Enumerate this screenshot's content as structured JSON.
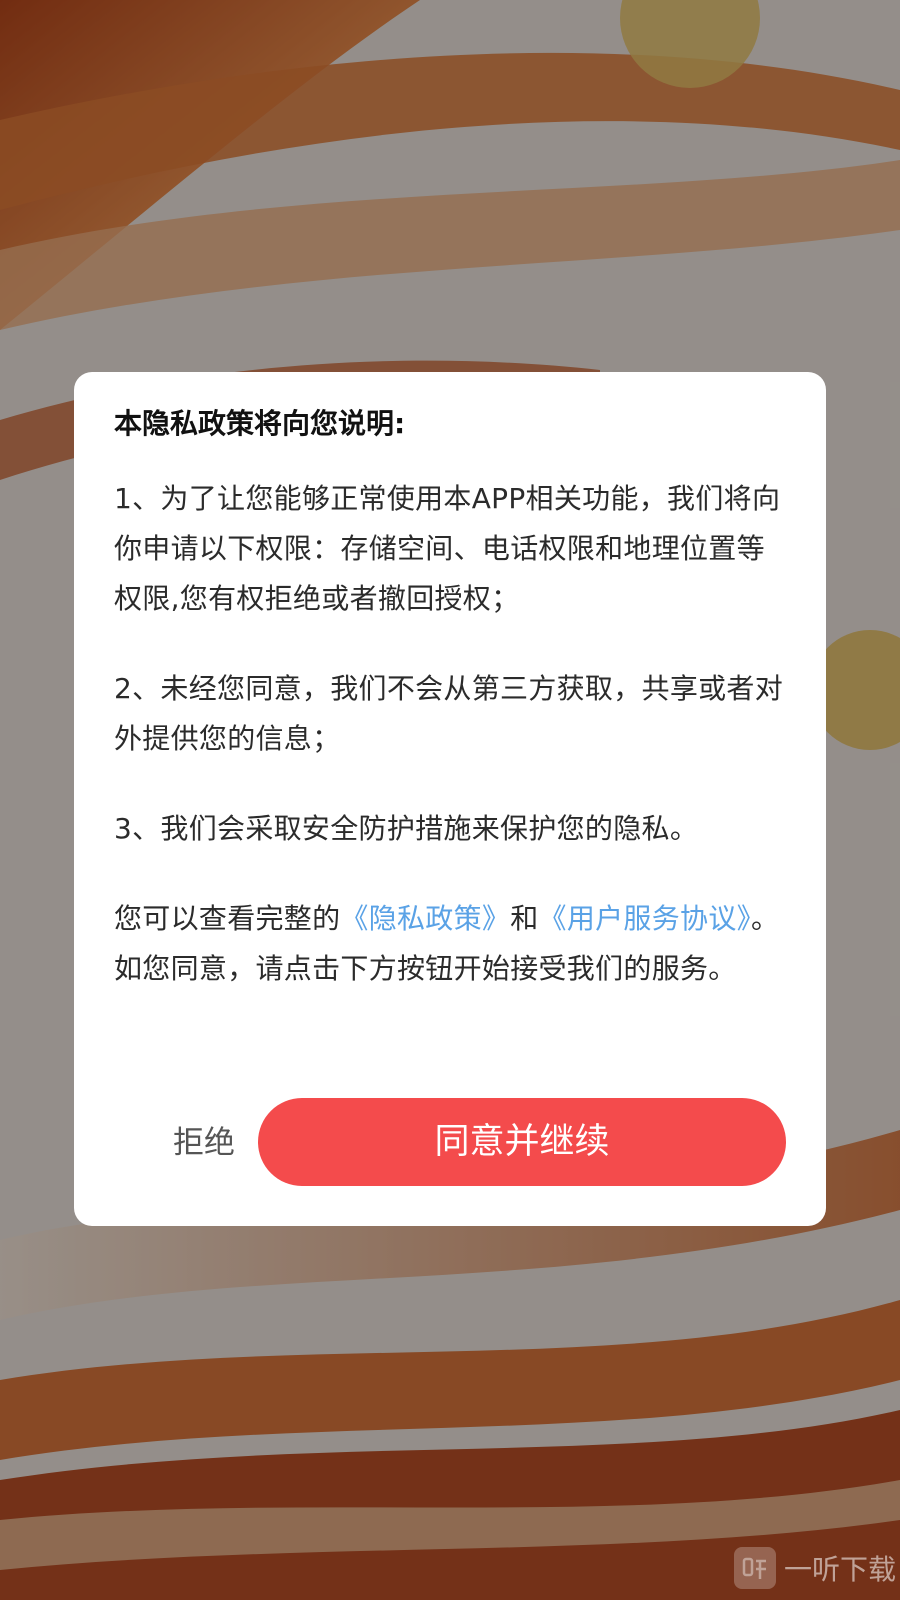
{
  "dialog": {
    "title": "本隐私政策将向您说明:",
    "item_1": "1、为了让您能够正常使用本APP相关功能，我们将向你申请以下权限：存储空间、电话权限和地理位置等权限,您有权拒绝或者撤回授权；",
    "item_2": "2、未经您同意，我们不会从第三方获取，共享或者对外提供您的信息；",
    "item_3": "3、我们会采取安全防护措施来保护您的隐私。",
    "notice": {
      "prefix": "您可以查看完整的",
      "privacy_link": "《隐私政策》",
      "and": "和",
      "terms_link": "《用户服务协议》",
      "suffix": "。如您同意，请点击下方按钮开始接受我们的服务。"
    },
    "reject_label": "拒绝",
    "agree_label": "同意并继续"
  },
  "watermark": {
    "text": "一听下载",
    "icon": "listen-logo-icon"
  },
  "colors": {
    "agree_button": "#f44b4c",
    "link": "#5aa2e6",
    "overlay": "rgba(0,0,0,0.38)",
    "background_accent": "#d9652a"
  }
}
